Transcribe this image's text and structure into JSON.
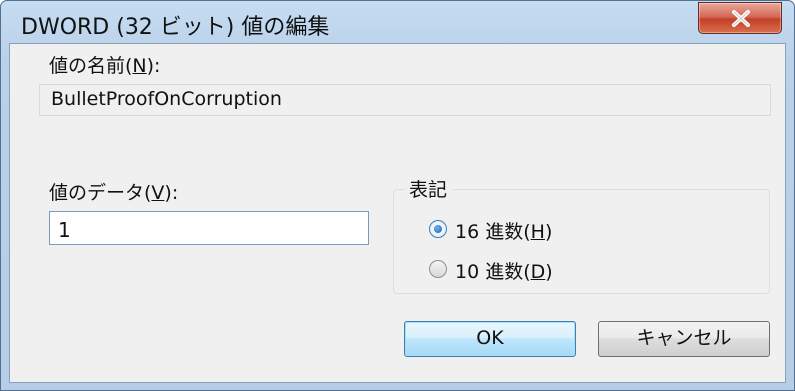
{
  "dialog": {
    "title": "DWORD (32 ビット) 値の編集",
    "close_label": "×"
  },
  "value_name": {
    "label_prefix": "値の名前(",
    "label_mnemonic": "N",
    "label_suffix": "):",
    "value": "BulletProofOnCorruption"
  },
  "value_data": {
    "label_prefix": "値のデータ(",
    "label_mnemonic": "V",
    "label_suffix": "):",
    "value": "1"
  },
  "base": {
    "legend": "表記",
    "options": [
      {
        "prefix": "16 進数(",
        "mnemonic": "H",
        "suffix": ")",
        "checked": true
      },
      {
        "prefix": "10 進数(",
        "mnemonic": "D",
        "suffix": ")",
        "checked": false
      }
    ]
  },
  "buttons": {
    "ok": "OK",
    "cancel": "キャンセル"
  },
  "colors": {
    "title_bar": "#b9d1ea",
    "close_button": "#c34128",
    "client_bg": "#f0f0f0",
    "default_button_border": "#3c7fb1"
  }
}
